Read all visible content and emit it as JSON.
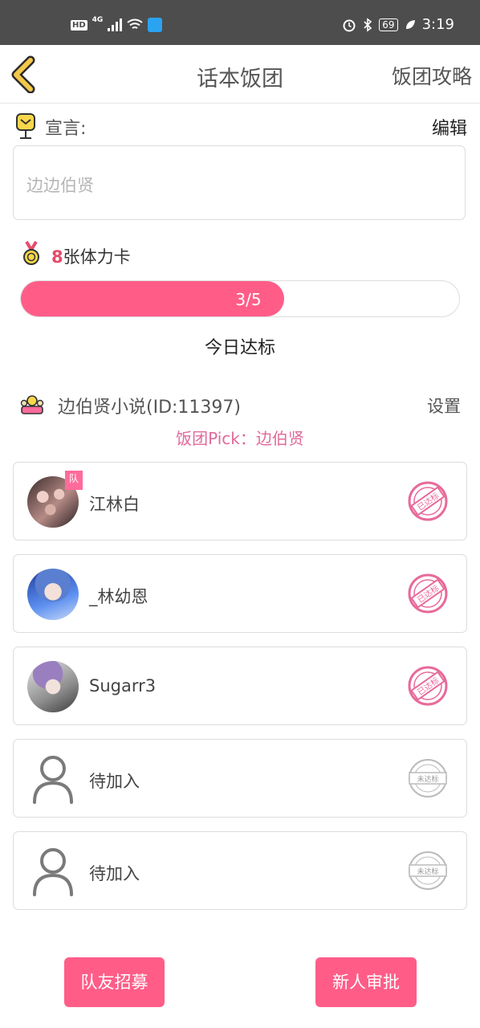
{
  "status_bar": {
    "hd": "HD",
    "network": "4G",
    "battery": "69",
    "time": "3:19"
  },
  "nav": {
    "title": "话本饭团",
    "right_link": "饭团攻略"
  },
  "declaration": {
    "label": "宣言:",
    "edit_label": "编辑",
    "text": "边边伯贤"
  },
  "stamina": {
    "count": "8",
    "suffix": "张体力卡"
  },
  "progress": {
    "text": "3/5",
    "fraction": 0.6,
    "status": "今日达标"
  },
  "group": {
    "name": "边伯贤小说(ID:11397)",
    "settings_label": "设置",
    "pick_line": "饭团Pick：边伯贤"
  },
  "members": [
    {
      "name": "江林白",
      "leader_tag": "队",
      "stamp": "已达标",
      "reached": true
    },
    {
      "name": "_林幼恩",
      "stamp": "已达标",
      "reached": true
    },
    {
      "name": "Sugarr3",
      "stamp": "已达标",
      "reached": true
    },
    {
      "name": "待加入",
      "stamp": "未达标",
      "reached": false
    },
    {
      "name": "待加入",
      "stamp": "未达标",
      "reached": false
    }
  ],
  "buttons": {
    "recruit": "队友招募",
    "approve": "新人审批"
  },
  "colors": {
    "accent": "#ff5d88",
    "pick_text": "#e06a9a",
    "stamp_reached": "#e86a9a",
    "stamp_unreached": "#bbbbbb"
  }
}
